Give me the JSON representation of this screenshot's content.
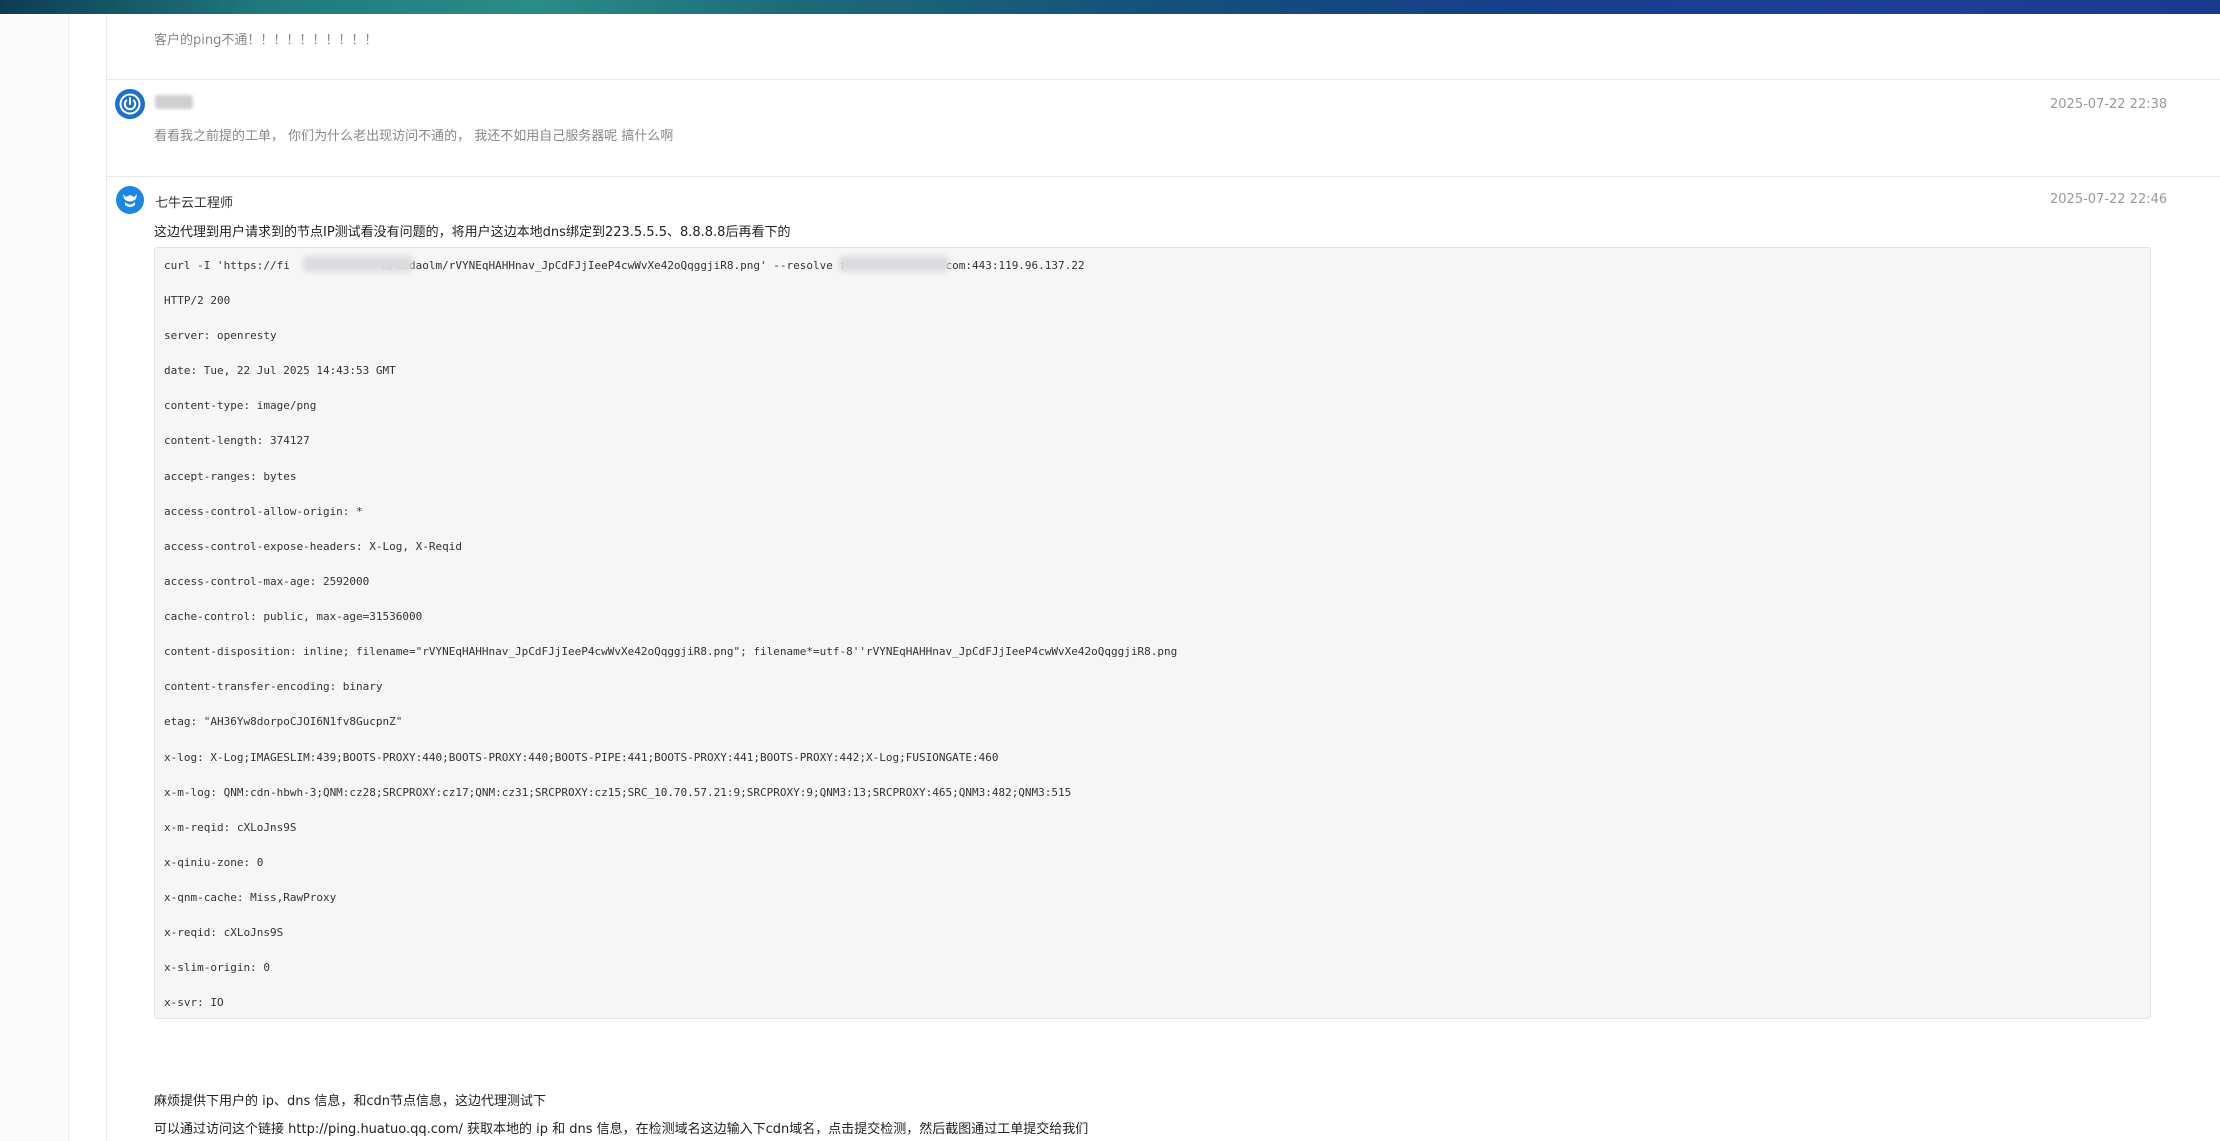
{
  "colors": {
    "accent_blue": "#1a73e8",
    "code_bg": "#f6f6f7"
  },
  "messages": [
    {
      "body": "客户的ping不通！！！！！！！！！！"
    },
    {
      "avatar_icon": "power-icon",
      "author": "",
      "time": "2025-07-22 22:38",
      "body": "看看我之前提的工单， 你们为什么老出现访问不通的， 我还不如用自己服务器呢  搞什么啊"
    },
    {
      "avatar_icon": "support-engineer-icon",
      "author": "七牛云工程师",
      "time": "2025-07-22 22:46",
      "intro": "这边代理到用户请求到的节点IP测试看没有问题的，将用户这边本地dns绑定到223.5.5.5、8.8.8.8后再看下的",
      "code_lines": [
        "curl -I 'https://fi              m/dedaolm/rVYNEqHAHHnav_JpCdFJjIeeP4cwWvXe42oQqggjiR8.png' --resolve f               com:443:119.96.137.22",
        "HTTP/2 200",
        "server: openresty",
        "date: Tue, 22 Jul 2025 14:43:53 GMT",
        "content-type: image/png",
        "content-length: 374127",
        "accept-ranges: bytes",
        "access-control-allow-origin: *",
        "access-control-expose-headers: X-Log, X-Reqid",
        "access-control-max-age: 2592000",
        "cache-control: public, max-age=31536000",
        "content-disposition: inline; filename=\"rVYNEqHAHHnav_JpCdFJjIeeP4cwWvXe42oQqggjiR8.png\"; filename*=utf-8''rVYNEqHAHHnav_JpCdFJjIeeP4cwWvXe42oQqggjiR8.png",
        "content-transfer-encoding: binary",
        "etag: \"AH36Yw8dorpoCJOI6N1fv8GucpnZ\"",
        "x-log: X-Log;IMAGESLIM:439;BOOTS-PROXY:440;BOOTS-PROXY:440;BOOTS-PIPE:441;BOOTS-PROXY:441;BOOTS-PROXY:442;X-Log;FUSIONGATE:460",
        "x-m-log: QNM:cdn-hbwh-3;QNM:cz28;SRCPROXY:cz17;QNM:cz31;SRCPROXY:cz15;SRC_10.70.57.21:9;SRCPROXY:9;QNM3:13;SRCPROXY:465;QNM3:482;QNM3:515",
        "x-m-reqid: cXLoJns9S",
        "x-qiniu-zone: 0",
        "x-qnm-cache: Miss,RawProxy",
        "x-reqid: cXLoJns9S",
        "x-slim-origin: 0",
        "x-svr: IO"
      ],
      "footer_1": "麻烦提供下用户的 ip、dns 信息，和cdn节点信息，这边代理测试下",
      "footer_2": "可以通过访问这个链接 http://ping.huatuo.qq.com/ 获取本地的 ip 和 dns 信息，在检测域名这边输入下cdn域名，点击提交检测，然后截图通过工单提交给我们"
    }
  ]
}
